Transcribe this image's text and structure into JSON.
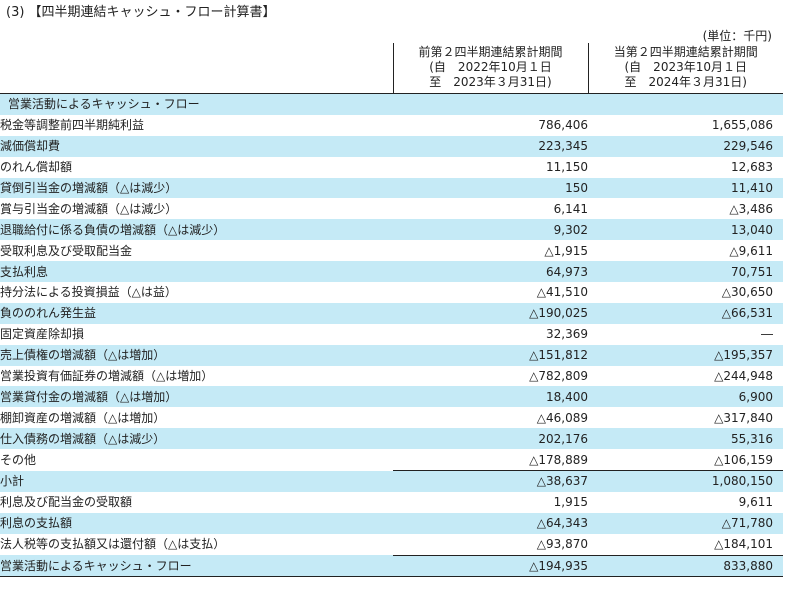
{
  "title": "(3) 【四半期連結キャッシュ・フロー計算書】",
  "unit": "(単位：千円)",
  "columns": {
    "prev": {
      "line1": "前第２四半期連結累計期間",
      "line2": "(自　2022年10月１日",
      "line3": "至　2023年３月31日)"
    },
    "cur": {
      "line1": "当第２四半期連結累計期間",
      "line2": "(自　2023年10月１日",
      "line3": "至　2024年３月31日)"
    }
  },
  "rows": [
    {
      "label": "営業活動によるキャッシュ・フロー",
      "prev": "",
      "cur": ""
    },
    {
      "label": "税金等調整前四半期純利益",
      "prev": "786,406",
      "cur": "1,655,086"
    },
    {
      "label": "減価償却費",
      "prev": "223,345",
      "cur": "229,546"
    },
    {
      "label": "のれん償却額",
      "prev": "11,150",
      "cur": "12,683"
    },
    {
      "label": "貸倒引当金の増減額（△は減少）",
      "prev": "150",
      "cur": "11,410"
    },
    {
      "label": "賞与引当金の増減額（△は減少）",
      "prev": "6,141",
      "cur": "△3,486"
    },
    {
      "label": "退職給付に係る負債の増減額（△は減少）",
      "prev": "9,302",
      "cur": "13,040"
    },
    {
      "label": "受取利息及び受取配当金",
      "prev": "△1,915",
      "cur": "△9,611"
    },
    {
      "label": "支払利息",
      "prev": "64,973",
      "cur": "70,751"
    },
    {
      "label": "持分法による投資損益（△は益）",
      "prev": "△41,510",
      "cur": "△30,650"
    },
    {
      "label": "負ののれん発生益",
      "prev": "△190,025",
      "cur": "△66,531"
    },
    {
      "label": "固定資産除却損",
      "prev": "32,369",
      "cur": "―"
    },
    {
      "label": "売上債権の増減額（△は増加）",
      "prev": "△151,812",
      "cur": "△195,357"
    },
    {
      "label": "営業投資有価証券の増減額（△は増加）",
      "prev": "△782,809",
      "cur": "△244,948"
    },
    {
      "label": "営業貸付金の増減額（△は増加）",
      "prev": "18,400",
      "cur": "6,900"
    },
    {
      "label": "棚卸資産の増減額（△は増加）",
      "prev": "△46,089",
      "cur": "△317,840"
    },
    {
      "label": "仕入債務の増減額（△は減少）",
      "prev": "202,176",
      "cur": "55,316"
    },
    {
      "label": "その他",
      "prev": "△178,889",
      "cur": "△106,159"
    },
    {
      "label": "小計",
      "prev": "△38,637",
      "cur": "1,080,150"
    },
    {
      "label": "利息及び配当金の受取額",
      "prev": "1,915",
      "cur": "9,611"
    },
    {
      "label": "利息の支払額",
      "prev": "△64,343",
      "cur": "△71,780"
    },
    {
      "label": "法人税等の支払額又は還付額（△は支払）",
      "prev": "△93,870",
      "cur": "△184,101"
    },
    {
      "label": "営業活動によるキャッシュ・フロー",
      "prev": "△194,935",
      "cur": "833,880"
    }
  ],
  "colors": {
    "row_shade": "#c5eaf6",
    "text": "#222222",
    "rule": "#222222"
  }
}
